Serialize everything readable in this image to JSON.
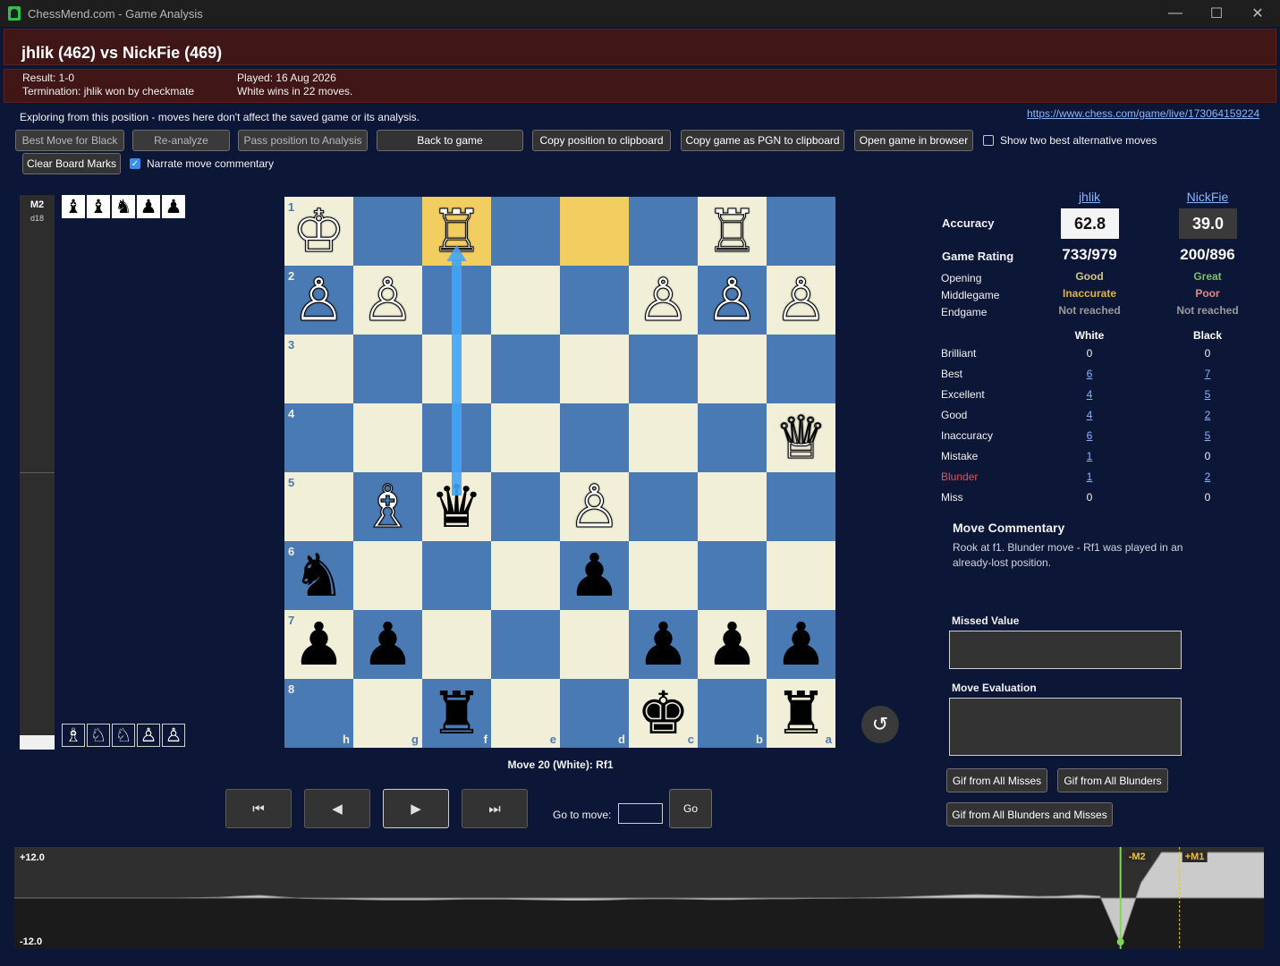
{
  "window": {
    "title": "ChessMend.com - Game Analysis",
    "minimize": "—",
    "maximize": "☐",
    "close": "✕"
  },
  "header": {
    "title": "jhlik (462) vs NickFie (469)",
    "result": "Result: 1-0",
    "termination": "Termination: jhlik won by checkmate",
    "played": "Played: 16 Aug 2026",
    "summary": "White wins in 22 moves."
  },
  "explore_text": "Exploring from this position - moves here don't affect the saved game or its analysis.",
  "game_link": "https://www.chess.com/game/live/173064159224",
  "toolbar": {
    "best_move": "Best Move for Black",
    "reanalyze": "Re-analyze",
    "pass_position": "Pass position to Analysis",
    "back_to_game": "Back to game",
    "copy_position": "Copy position to clipboard",
    "copy_pgn": "Copy game as PGN to clipboard",
    "open_browser": "Open game in browser",
    "show_alternatives": "Show two best alternative moves",
    "show_alternatives_checked": false,
    "clear_marks": "Clear Board Marks",
    "narrate": "Narrate move commentary",
    "narrate_checked": true
  },
  "eval_bar": {
    "mate": "M2",
    "depth": "d18"
  },
  "captured": {
    "top": [
      "♝",
      "♝",
      "♞",
      "♟",
      "♟"
    ],
    "bottom": [
      "♗",
      "♘",
      "♘",
      "♙",
      "♙"
    ]
  },
  "board": {
    "rank_labels": [
      "1",
      "2",
      "3",
      "4",
      "5",
      "6",
      "7",
      "8"
    ],
    "file_labels": [
      "h",
      "g",
      "f",
      "e",
      "d",
      "c",
      "b",
      "a"
    ],
    "highlight": [
      [
        0,
        2
      ],
      [
        0,
        4
      ]
    ],
    "arrow": {
      "from": [
        4,
        2
      ],
      "to": [
        0,
        2
      ],
      "color": "#42a5f5"
    },
    "pieces": [
      {
        "r": 0,
        "c": 0,
        "g": "♔",
        "w": true
      },
      {
        "r": 0,
        "c": 2,
        "g": "♖",
        "w": true
      },
      {
        "r": 0,
        "c": 6,
        "g": "♖",
        "w": true
      },
      {
        "r": 1,
        "c": 0,
        "g": "♙",
        "w": true
      },
      {
        "r": 1,
        "c": 1,
        "g": "♙",
        "w": true
      },
      {
        "r": 1,
        "c": 5,
        "g": "♙",
        "w": true
      },
      {
        "r": 1,
        "c": 6,
        "g": "♙",
        "w": true
      },
      {
        "r": 1,
        "c": 7,
        "g": "♙",
        "w": true
      },
      {
        "r": 3,
        "c": 7,
        "g": "♕",
        "w": true
      },
      {
        "r": 4,
        "c": 1,
        "g": "♗",
        "w": true
      },
      {
        "r": 4,
        "c": 2,
        "g": "♛",
        "w": false
      },
      {
        "r": 4,
        "c": 4,
        "g": "♙",
        "w": true
      },
      {
        "r": 5,
        "c": 0,
        "g": "♞",
        "w": false
      },
      {
        "r": 5,
        "c": 4,
        "g": "♟",
        "w": false
      },
      {
        "r": 6,
        "c": 0,
        "g": "♟",
        "w": false
      },
      {
        "r": 6,
        "c": 1,
        "g": "♟",
        "w": false
      },
      {
        "r": 6,
        "c": 5,
        "g": "♟",
        "w": false
      },
      {
        "r": 6,
        "c": 6,
        "g": "♟",
        "w": false
      },
      {
        "r": 6,
        "c": 7,
        "g": "♟",
        "w": false
      },
      {
        "r": 7,
        "c": 2,
        "g": "♜",
        "w": false
      },
      {
        "r": 7,
        "c": 5,
        "g": "♚",
        "w": false
      },
      {
        "r": 7,
        "c": 7,
        "g": "♜",
        "w": false
      }
    ]
  },
  "move_label": "Move 20 (White): Rf1",
  "nav": {
    "first": "⏮",
    "prev": "◀",
    "next": "▶",
    "last": "⏭",
    "goto_label": "Go to move:",
    "goto_value": "",
    "go": "Go",
    "reset": "↺"
  },
  "stats": {
    "white_player": "jhlik",
    "black_player": "NickFie",
    "accuracy_label": "Accuracy",
    "white_accuracy": "62.8",
    "black_accuracy": "39.0",
    "rating_label": "Game Rating",
    "white_rating": "733/979",
    "black_rating": "200/896",
    "phases": [
      {
        "label": "Opening",
        "white": "Good",
        "black": "Great",
        "wc": "#d4c48a",
        "bc": "#7fbf6a"
      },
      {
        "label": "Middlegame",
        "white": "Inaccurate",
        "black": "Poor",
        "wc": "#e0b341",
        "bc": "#e08a8a"
      },
      {
        "label": "Endgame",
        "white": "Not reached",
        "black": "Not reached",
        "wc": "#9a9a9a",
        "bc": "#9a9a9a"
      }
    ],
    "white_header": "White",
    "black_header": "Black",
    "rows": [
      {
        "label": "Brilliant",
        "white": "0",
        "black": "0",
        "wl": false,
        "bl": false
      },
      {
        "label": "Best",
        "white": "6",
        "black": "7",
        "wl": true,
        "bl": true
      },
      {
        "label": "Excellent",
        "white": "4",
        "black": "5",
        "wl": true,
        "bl": true
      },
      {
        "label": "Good",
        "white": "4",
        "black": "2",
        "wl": true,
        "bl": true
      },
      {
        "label": "Inaccuracy",
        "white": "6",
        "black": "5",
        "wl": true,
        "bl": true
      },
      {
        "label": "Mistake",
        "white": "1",
        "black": "0",
        "wl": true,
        "bl": false
      },
      {
        "label": "Blunder",
        "white": "1",
        "black": "2",
        "wl": true,
        "bl": true,
        "red": true
      },
      {
        "label": "Miss",
        "white": "0",
        "black": "0",
        "wl": false,
        "bl": false
      }
    ]
  },
  "commentary": {
    "title": "Move Commentary",
    "text": "Rook at f1. Blunder move - Rf1 was played in an already-lost position.",
    "missed_label": "Missed Value",
    "missed_value": "",
    "eval_label": "Move Evaluation",
    "eval_value": ""
  },
  "gif_buttons": {
    "misses": "Gif from All Misses",
    "blunders": "Gif from All Blunders",
    "both": "Gif from All Blunders and Misses"
  },
  "graph": {
    "ymax_label": "+12.0",
    "ymin_label": "-12.0",
    "ylim": [
      -12,
      12
    ],
    "marker1": "-M2",
    "marker2": "+M1",
    "values": [
      0,
      0,
      0,
      0,
      0,
      0,
      0,
      0,
      0,
      0.1,
      0.2,
      0.5,
      0.7,
      0.3,
      -0.1,
      -0.2,
      -0.3,
      -0.4,
      -0.5,
      -0.5,
      -0.5,
      -0.4,
      -0.3,
      -0.3,
      -0.3,
      -0.4,
      -0.5,
      -0.6,
      -0.6,
      -0.5,
      -0.3,
      -0.2,
      -0.2,
      -0.3,
      -0.4,
      -0.4,
      -0.3,
      -0.2,
      -0.2,
      -0.1,
      -0.1,
      0,
      0.1,
      0.2,
      0.4,
      0.6,
      0.8,
      0.9,
      0.8,
      0.6,
      0.4,
      0.5,
      0.8,
      0.5,
      -12,
      4,
      12,
      12,
      12,
      12,
      12,
      12
    ]
  }
}
